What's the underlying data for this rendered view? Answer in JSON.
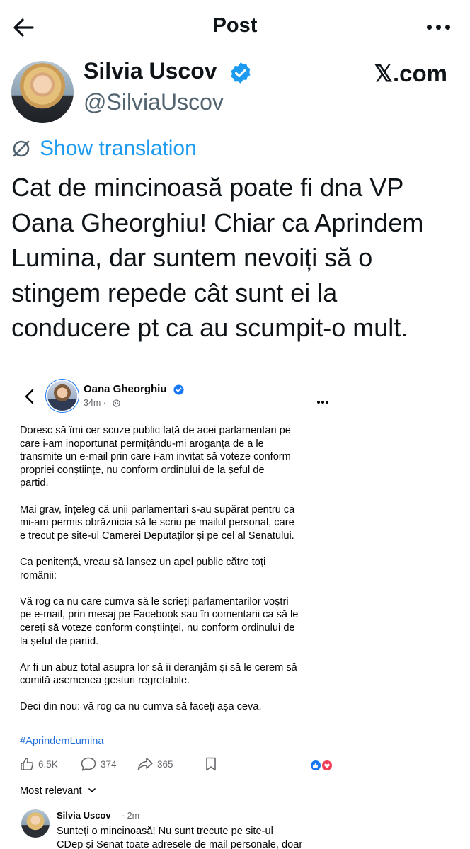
{
  "header": {
    "title": "Post"
  },
  "author": {
    "name": "Silvia Uscov",
    "handle": "@SilviaUscov",
    "source": "𝕏.com"
  },
  "translation": {
    "label": "Show translation"
  },
  "tweet": {
    "lines": [
      "Cat de mincinoasă poate fi dna VP",
      "Oana Gheorghiu! Chiar ca Aprindem",
      "Lumina, dar suntem nevoiți să o",
      "stingem repede cât sunt ei la",
      "conducere pt ca au scumpit-o mult."
    ]
  },
  "fb_post": {
    "name": "Oana Gheorghiu",
    "time": "34m ·",
    "paragraphs": [
      [
        "Doresc să îmi cer scuze public față de acei parlamentari pe",
        "care i-am inoportunat permițându-mi aroganța de a le",
        "transmite un e-mail prin care i-am invitat să voteze conform",
        "propriei conștiințe, nu conform ordinului de la șeful de",
        "partid."
      ],
      [
        "Mai grav, înțeleg că unii parlamentari s-au supărat pentru ca",
        "mi-am permis obrăznicia să le scriu pe mailul personal, care",
        "e trecut pe site-ul Camerei Deputaților și pe cel al Senatului."
      ],
      [
        "Ca penitență, vreau să lansez un apel public către toți",
        "românii:"
      ],
      [
        "Vă rog ca nu care cumva să le scrieți parlamentarilor voștri",
        "pe e-mail, prin mesaj pe Facebook sau în comentarii ca să le",
        "cereți să voteze conform conștiinței, nu conform ordinului de",
        "la șeful de partid."
      ],
      [
        "Ar fi un abuz total asupra lor să îi deranjăm și să le cerem să",
        "comită asemenea gesturi regretabile."
      ],
      [
        "Deci din nou: vă rog ca nu cumva să faceți așa ceva."
      ]
    ],
    "hashtag": "#AprindemLumina",
    "likes": "6.5K",
    "comments": "374",
    "shares": "365",
    "sort": "Most relevant"
  },
  "comment": {
    "name": "Silvia Uscov",
    "time": "· 2m",
    "lines": [
      "Sunteți o mincinoasă! Nu sunt trecute  pe site-ul",
      "CDep și Senat toate adresele de mail personale, doar"
    ]
  },
  "colors": {
    "accent": "#1d9bf0",
    "fb_blue": "#1877f2",
    "link": "#216fdb",
    "muted": "#536471"
  }
}
